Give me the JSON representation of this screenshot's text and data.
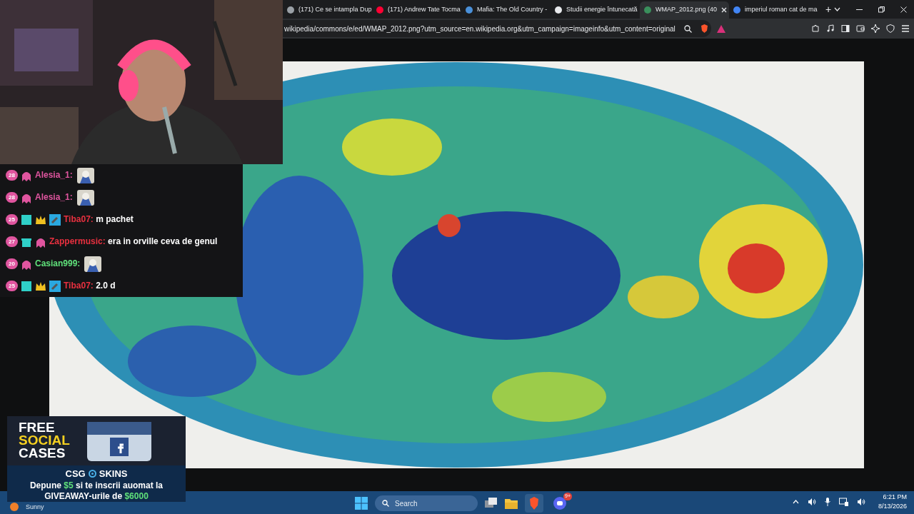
{
  "browser": {
    "tabs": [
      {
        "title": "(171) Ce se intampla Dup",
        "selected": false,
        "color": "#9aa0a6"
      },
      {
        "title": "(171) Andrew Tate Tocma",
        "selected": false,
        "color": "#ff0033"
      },
      {
        "title": "Mafia: The Old Country -",
        "selected": false,
        "color": "#4a90d9"
      },
      {
        "title": "Studii energie întunecată",
        "selected": false,
        "color": "#e8eaed"
      },
      {
        "title": "WMAP_2012.png (40",
        "selected": true,
        "color": "#3a8f5c"
      },
      {
        "title": "imperiul roman cat de ma",
        "selected": false,
        "color": "#4285f4"
      }
    ],
    "new_tab": "+",
    "address": "wikipedia/commons/e/ed/WMAP_2012.png?utm_source=en.wikipedia.org&utm_campaign=imageinfo&utm_content=original"
  },
  "chat": {
    "messages": [
      {
        "level": "28",
        "badges": [
          {
            "kind": "ghost"
          }
        ],
        "user": "Alesia_1:",
        "color": "#e0559f",
        "emote": true
      },
      {
        "level": "28",
        "badges": [
          {
            "kind": "ghost"
          }
        ],
        "user": "Alesia_1:",
        "color": "#e0559f",
        "emote": true
      },
      {
        "level": "25",
        "badges": [
          {
            "kind": "gem"
          },
          {
            "kind": "crown"
          },
          {
            "kind": "hammer"
          }
        ],
        "user": "Tiba07:",
        "color": "#e8303f",
        "text": "m pachet"
      },
      {
        "level": "27",
        "badges": [
          {
            "kind": "gift"
          },
          {
            "kind": "ghost"
          }
        ],
        "user": "Zappermusic:",
        "color": "#e8303f",
        "text": "era in orville ceva de genul"
      },
      {
        "level": "20",
        "badges": [
          {
            "kind": "ghost"
          }
        ],
        "user": "Casian999:",
        "color": "#5fe07a",
        "emote": true
      },
      {
        "level": "25",
        "badges": [
          {
            "kind": "gem"
          },
          {
            "kind": "crown"
          },
          {
            "kind": "hammer"
          }
        ],
        "user": "Tiba07:",
        "color": "#e8303f",
        "text": "2.0 d"
      }
    ]
  },
  "promo": {
    "headline": [
      "FREE",
      "SOCIAL",
      "CASES"
    ],
    "brand": [
      "CSG",
      "SKINS"
    ],
    "lines": [
      [
        {
          "text": "Depune "
        },
        {
          "text": "$5",
          "highlight": true
        },
        {
          "text": " si te inscrii auomat la"
        }
      ],
      [
        {
          "text": "GIVEAWAY-urile de "
        },
        {
          "text": "$6000",
          "highlight": true
        }
      ]
    ]
  },
  "taskbar": {
    "weather": "Sunny",
    "search_placeholder": "Search",
    "discord_badge": "9+",
    "time": "6:21 PM",
    "date": "8/13/2026"
  }
}
